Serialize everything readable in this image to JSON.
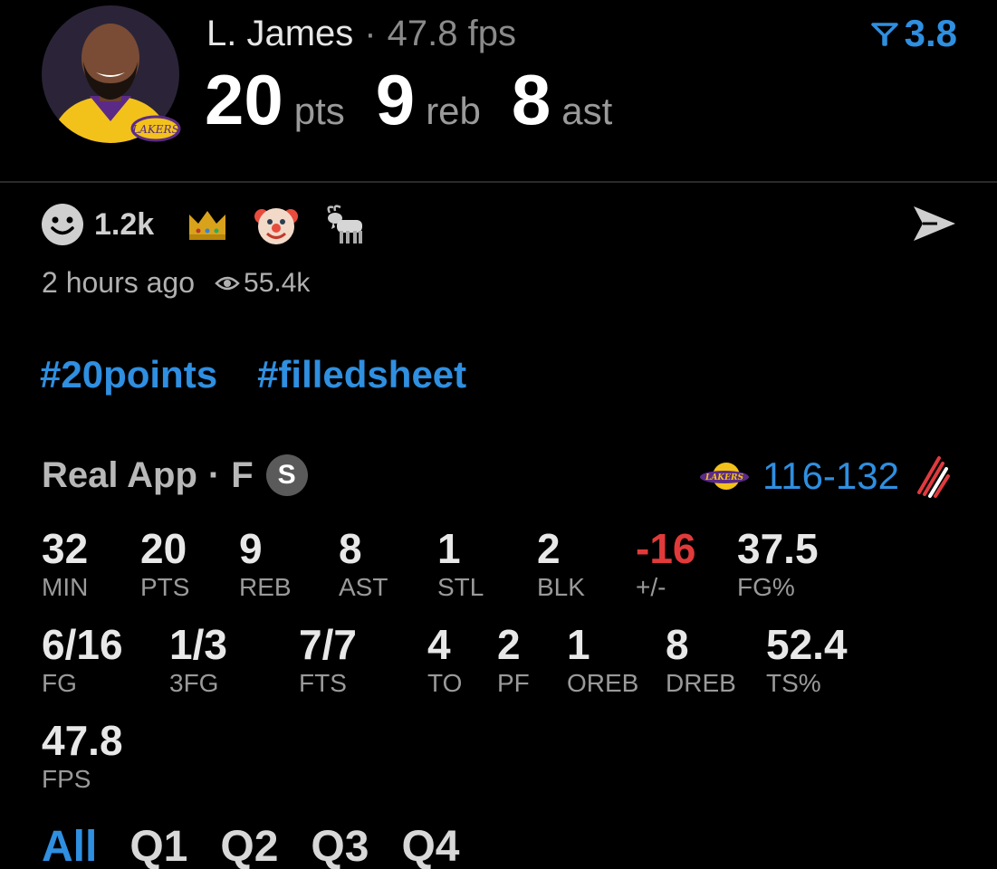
{
  "header": {
    "player_name": "L. James",
    "separator": "·",
    "fps_text": "47.8 fps",
    "rating": "3.8",
    "big_stats": [
      {
        "value": "20",
        "unit": "pts"
      },
      {
        "value": "9",
        "unit": "reb"
      },
      {
        "value": "8",
        "unit": "ast"
      }
    ]
  },
  "reactions": {
    "count": "1.2k",
    "emojis": [
      "crown-emoji",
      "clown-emoji",
      "goat-emoji"
    ]
  },
  "meta": {
    "time_ago": "2 hours ago",
    "views": "55.4k"
  },
  "hashtags": [
    "#20points",
    "#filledsheet"
  ],
  "game": {
    "source": "Real App",
    "separator": "·",
    "position": "F",
    "badge": "S",
    "score": "116-132"
  },
  "stats": [
    {
      "value": "32",
      "label": "MIN"
    },
    {
      "value": "20",
      "label": "PTS"
    },
    {
      "value": "9",
      "label": "REB"
    },
    {
      "value": "8",
      "label": "AST"
    },
    {
      "value": "1",
      "label": "STL"
    },
    {
      "value": "2",
      "label": "BLK"
    },
    {
      "value": "-16",
      "label": "+/-"
    },
    {
      "value": "37.5",
      "label": "FG%"
    },
    {
      "value": "6/16",
      "label": "FG"
    },
    {
      "value": "1/3",
      "label": "3FG"
    },
    {
      "value": "7/7",
      "label": "FTS"
    },
    {
      "value": "4",
      "label": "TO"
    },
    {
      "value": "2",
      "label": "PF"
    },
    {
      "value": "1",
      "label": "OREB"
    },
    {
      "value": "8",
      "label": "DREB"
    },
    {
      "value": "52.4",
      "label": "TS%"
    },
    {
      "value": "47.8",
      "label": "FPS"
    }
  ],
  "tabs": [
    "All",
    "Q1",
    "Q2",
    "Q3",
    "Q4"
  ],
  "colors": {
    "accent": "#2f8fe0",
    "negative": "#e23a3a",
    "background": "#000000"
  }
}
